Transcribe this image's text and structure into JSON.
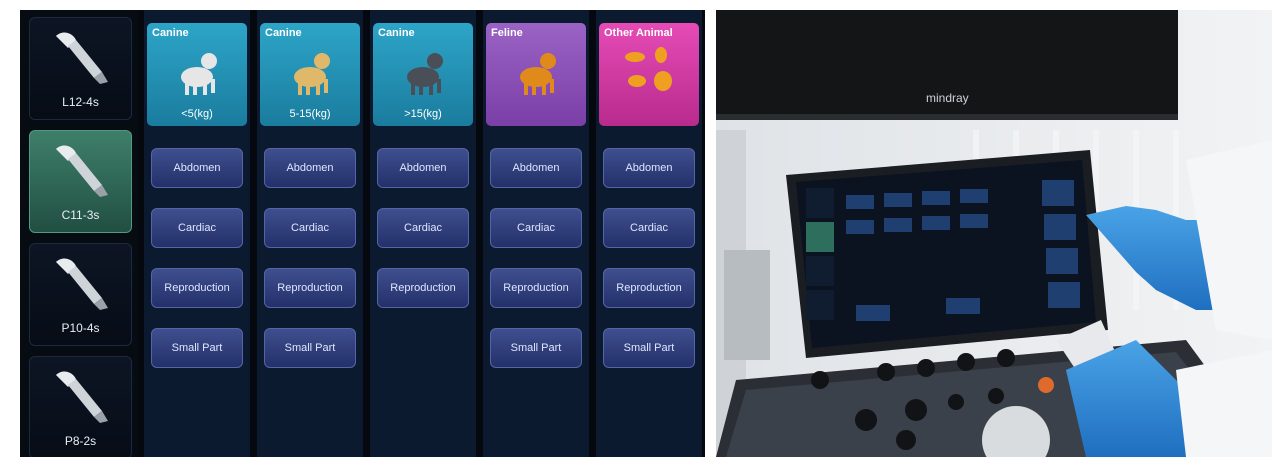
{
  "probes": [
    {
      "label": "L12-4s",
      "active": false
    },
    {
      "label": "C11-3s",
      "active": true
    },
    {
      "label": "P10-4s",
      "active": false
    },
    {
      "label": "P8-2s",
      "active": false
    }
  ],
  "columns": [
    {
      "title": "Canine",
      "sub": "<5(kg)",
      "style": "canine",
      "icon": "small-dog-icon",
      "buttons": [
        "Abdomen",
        "Cardiac",
        "Reproduction",
        "Small Part"
      ]
    },
    {
      "title": "Canine",
      "sub": "5-15(kg)",
      "style": "canine",
      "icon": "medium-dog-icon",
      "buttons": [
        "Abdomen",
        "Cardiac",
        "Reproduction",
        "Small Part"
      ]
    },
    {
      "title": "Canine",
      "sub": ">15(kg)",
      "style": "canine",
      "icon": "large-dog-icon",
      "buttons": [
        "Abdomen",
        "Cardiac",
        "Reproduction"
      ]
    },
    {
      "title": "Feline",
      "sub": "",
      "style": "feline",
      "icon": "cat-icon",
      "buttons": [
        "Abdomen",
        "Cardiac",
        "Reproduction",
        "Small Part"
      ]
    },
    {
      "title": "Other Animal",
      "sub": "",
      "style": "other",
      "icon": "other-animals-icon",
      "buttons": [
        "Abdomen",
        "Cardiac",
        "Reproduction",
        "Small Part"
      ]
    }
  ],
  "photo": {
    "brand": "mindray"
  },
  "colors": {
    "canine": "#2da5c8",
    "feline": "#9a63c4",
    "other": "#e64bb6",
    "active_probe": "#3e7f6a",
    "button": "#3f4f8e"
  }
}
